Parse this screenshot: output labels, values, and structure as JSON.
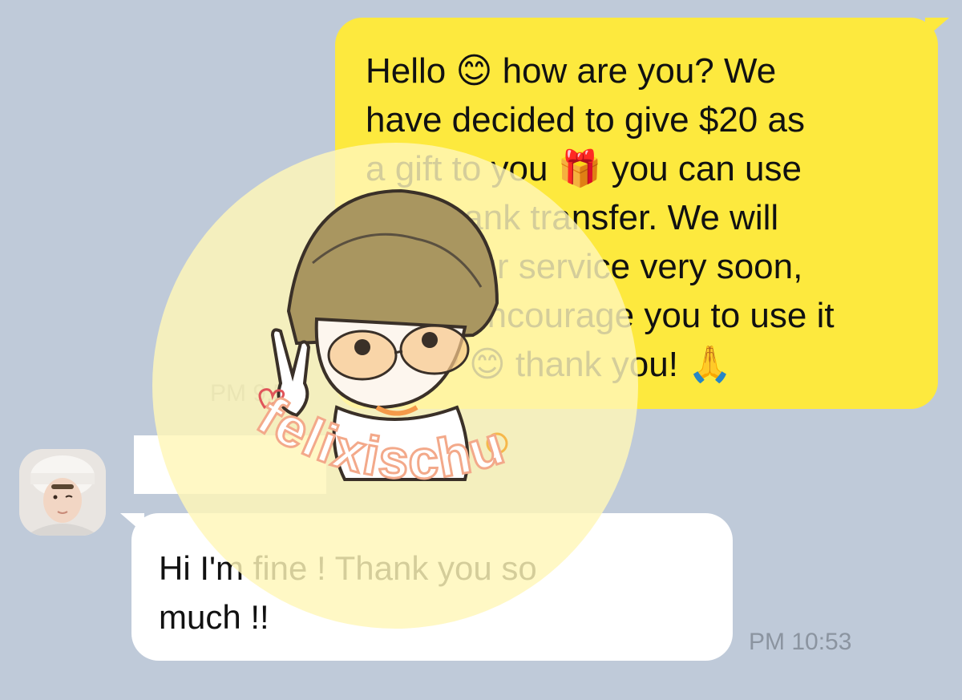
{
  "outgoing": {
    "text": "Hello 😊 how are you? We\nhave decided to give $20 as\na gift to you 🎁 you can use\nit for bank transfer. We will\nclose our service very soon,\nso we encourage you to use it\nASAP 😊 thank you! 🙏",
    "time": "PM 9:53"
  },
  "incoming": {
    "sender_name": "",
    "text": "Hi I'm fine ! Thank you so\nmuch !!",
    "time": "PM 10:53"
  },
  "watermark": {
    "text": "felixischu"
  },
  "icons": {
    "avatar": "contact-avatar-photo",
    "sticker": "girl-glasses-peace-sign-sticker"
  },
  "colors": {
    "background": "#bfcad9",
    "outgoing_bubble": "#fde93e",
    "incoming_bubble": "#ffffff",
    "timestamp": "#8b94a0"
  }
}
